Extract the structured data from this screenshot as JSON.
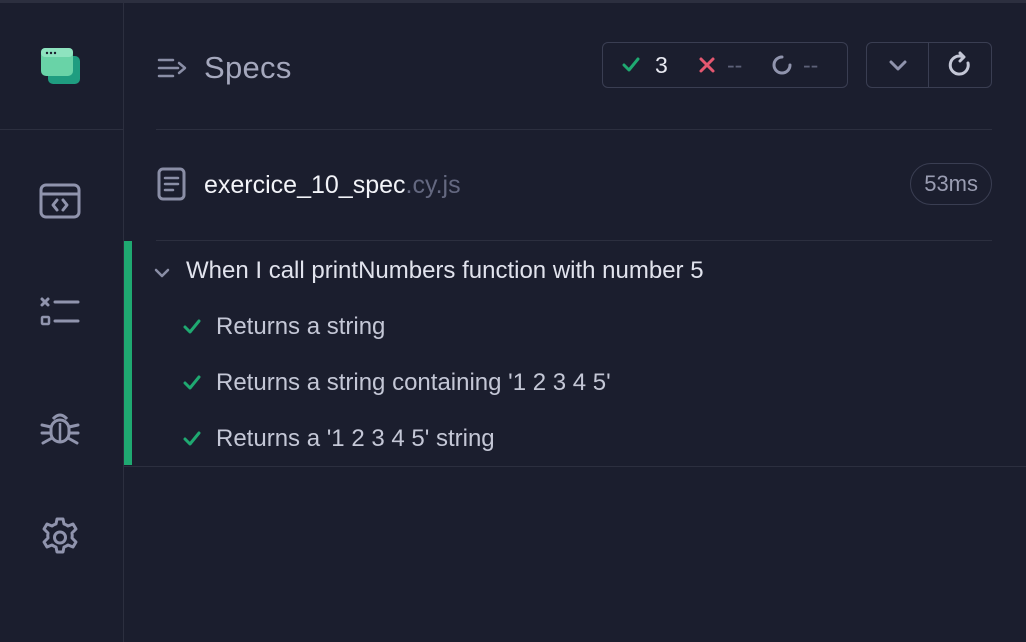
{
  "app": {
    "sidebar": {
      "nav_icons": [
        "runner-logo",
        "browser-code-icon",
        "test-list-icon",
        "bug-icon",
        "gear-icon"
      ]
    },
    "header": {
      "title": "Specs",
      "stats": {
        "passed": "3",
        "failed": "--",
        "pending": "--"
      }
    },
    "spec": {
      "file_base": "exercice_10_spec",
      "file_ext": ".cy.js",
      "duration": "53ms",
      "suite_title": "When I call printNumbers function with number 5",
      "tests": [
        {
          "label": "Returns a string",
          "status": "passed"
        },
        {
          "label": "Returns a string containing '1 2 3 4 5'",
          "status": "passed"
        },
        {
          "label": "Returns a '1 2 3 4 5' string",
          "status": "passed"
        }
      ]
    },
    "colors": {
      "background": "#1b1e2e",
      "pass": "#1fa971",
      "fail": "#e45770",
      "logo": "#69d3a7"
    }
  }
}
